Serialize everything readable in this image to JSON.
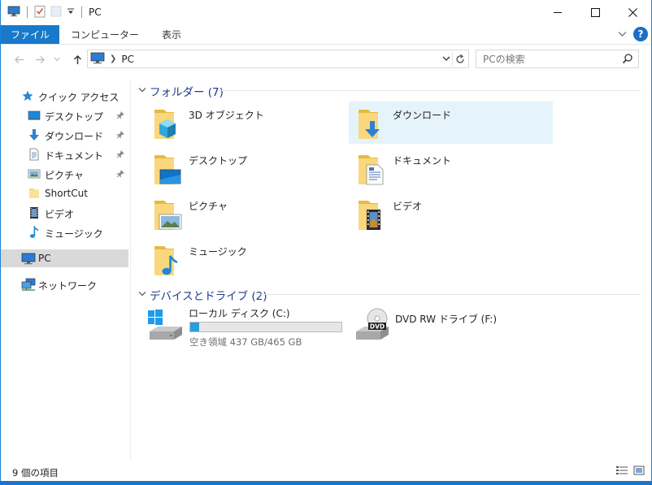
{
  "window": {
    "title": "PC",
    "accent": "#1979ca"
  },
  "ribbon": {
    "tabs": [
      {
        "label": "ファイル"
      },
      {
        "label": "コンピューター"
      },
      {
        "label": "表示"
      }
    ]
  },
  "address": {
    "crumb": "PC",
    "search_placeholder": "PCの検索"
  },
  "nav": {
    "quick_access": "クイック アクセス",
    "items": [
      {
        "label": "デスクトップ",
        "icon": "desktop-icon",
        "pinned": true
      },
      {
        "label": "ダウンロード",
        "icon": "download-icon",
        "pinned": true
      },
      {
        "label": "ドキュメント",
        "icon": "document-icon",
        "pinned": true
      },
      {
        "label": "ピクチャ",
        "icon": "picture-icon",
        "pinned": true
      },
      {
        "label": "ShortCut",
        "icon": "folder-icon",
        "pinned": false
      },
      {
        "label": "ビデオ",
        "icon": "video-icon",
        "pinned": false
      },
      {
        "label": "ミュージック",
        "icon": "music-icon",
        "pinned": false
      }
    ],
    "pc": "PC",
    "network": "ネットワーク"
  },
  "content": {
    "folders_group": "フォルダー (7)",
    "folders": [
      {
        "label": "3D オブジェクト",
        "icon": "3d-objects-folder-icon"
      },
      {
        "label": "ダウンロード",
        "icon": "downloads-folder-icon"
      },
      {
        "label": "デスクトップ",
        "icon": "desktop-folder-icon"
      },
      {
        "label": "ドキュメント",
        "icon": "documents-folder-icon"
      },
      {
        "label": "ピクチャ",
        "icon": "pictures-folder-icon"
      },
      {
        "label": "ビデオ",
        "icon": "videos-folder-icon"
      },
      {
        "label": "ミュージック",
        "icon": "music-folder-icon"
      }
    ],
    "drives_group": "デバイスとドライブ (2)",
    "drives": [
      {
        "label": "ローカル ディスク (C:)",
        "free_text": "空き領域 437 GB/465 GB",
        "used_fraction": 0.06
      },
      {
        "label": "DVD RW ドライブ (F:)"
      }
    ]
  },
  "status": {
    "item_count": "9 個の項目"
  }
}
